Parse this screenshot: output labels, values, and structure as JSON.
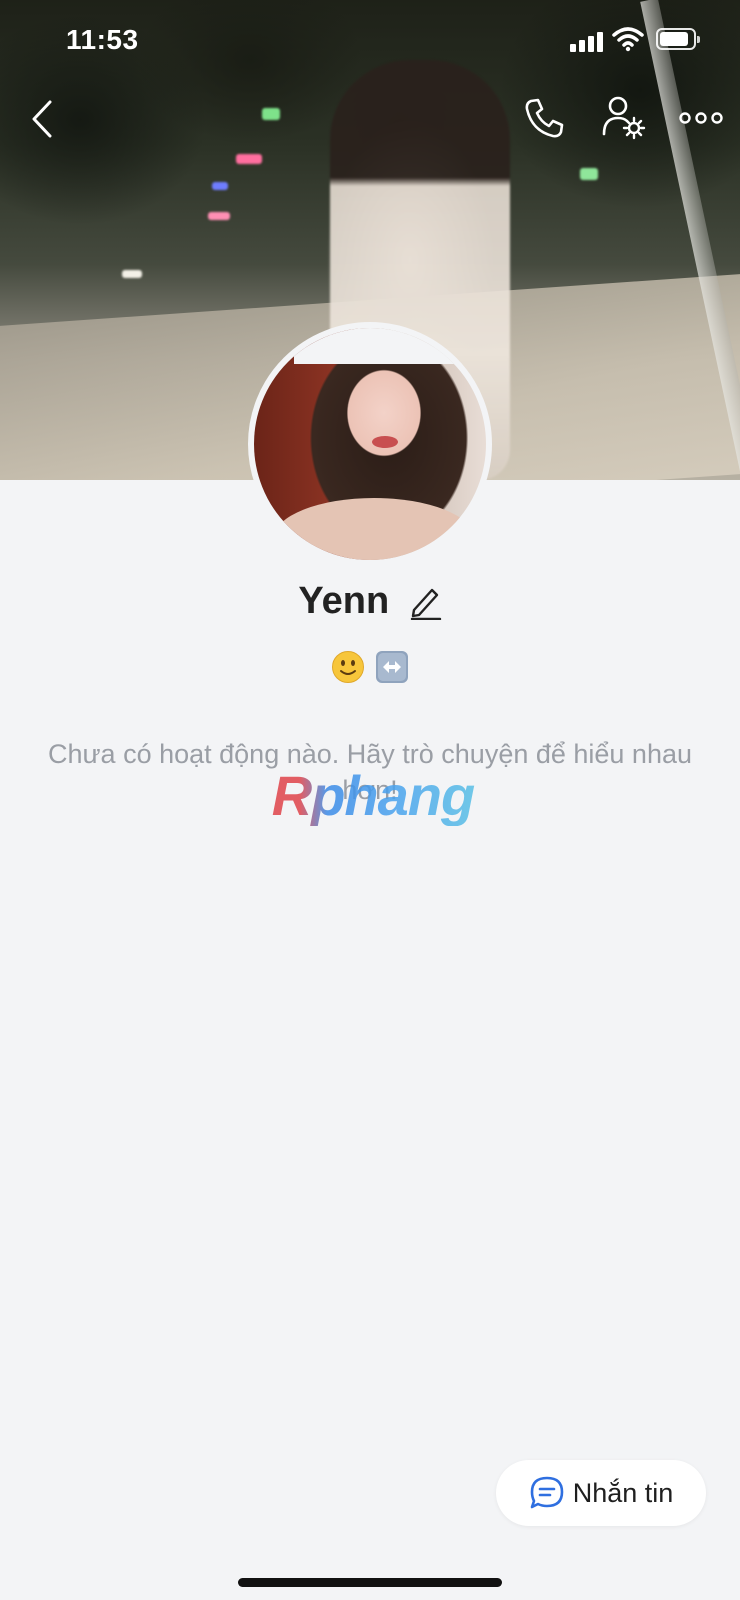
{
  "status_bar": {
    "time": "11:53",
    "icons": [
      "signal-icon",
      "wifi-icon",
      "battery-icon"
    ]
  },
  "header": {
    "actions": [
      "back-icon",
      "phone-icon",
      "profile-settings-icon",
      "more-icon"
    ]
  },
  "profile": {
    "name": "Yenn",
    "status_emojis": [
      "slightly-smiling-face",
      "left-right-arrow"
    ]
  },
  "activity": {
    "empty_message": "Chưa có hoạt động nào. Hãy trò chuyện để hiểu nhau hơn!"
  },
  "watermark": {
    "text": "Rphang"
  },
  "message_button": {
    "label": "Nhắn tin",
    "icon": "chat-bubble-icon",
    "accent": "#2f6fe0"
  }
}
